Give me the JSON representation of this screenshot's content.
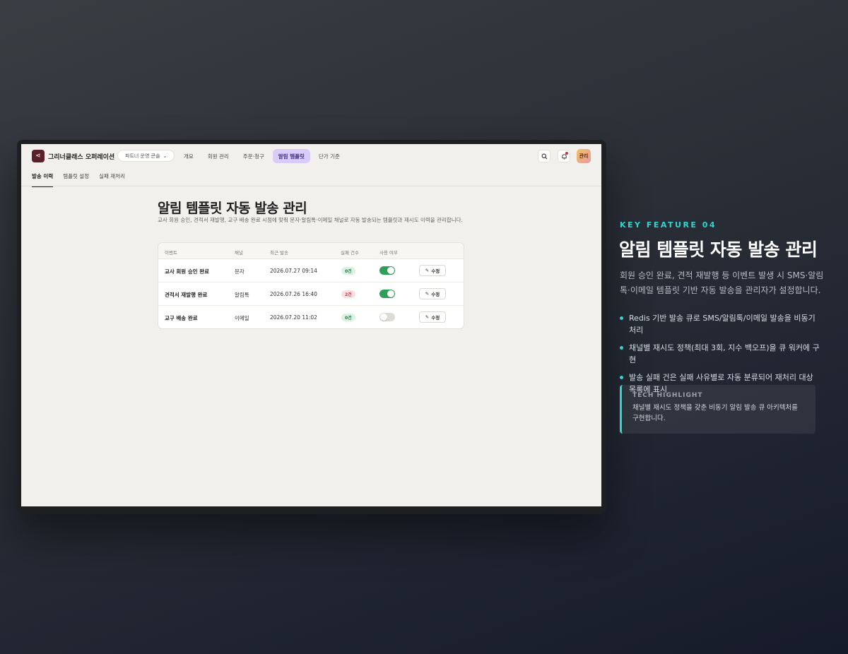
{
  "app": {
    "logo_glyph": "⋖",
    "brand": "그리너클래스 오퍼레이션",
    "workspace": "파트너 운영 콘솔",
    "nav": [
      "개요",
      "회원 관리",
      "주문·청구",
      "알림 템플릿",
      "단가 기준"
    ],
    "nav_active": "알림 템플릿",
    "avatar_label": "관리"
  },
  "subtabs": [
    "발송 이력",
    "템플릿 설정",
    "실패 재처리"
  ],
  "subtab_active": "발송 이력",
  "page": {
    "title": "알림 템플릿 자동 발송 관리",
    "description": "교사 회원 승인, 견적서 재발행, 교구 배송 완료 시점에 맞춰 문자·알림톡·이메일 채널로 자동 발송되는 템플릿과 재시도 이력을 관리합니다."
  },
  "table": {
    "headers": [
      "이벤트",
      "채널",
      "최근 발송",
      "실패 건수",
      "사용 여부"
    ],
    "edit_label": "수정",
    "rows": [
      {
        "event": "교사 회원 승인 완료",
        "channel": "문자",
        "last_sent": "2026.07.27 09:14",
        "failures": "0건",
        "failure_status": "ok",
        "enabled": true
      },
      {
        "event": "견적서 재발행 완료",
        "channel": "알림톡",
        "last_sent": "2026.07.26 16:40",
        "failures": "2건",
        "failure_status": "fail",
        "enabled": true
      },
      {
        "event": "교구 배송 완료",
        "channel": "이메일",
        "last_sent": "2026.07.20 11:02",
        "failures": "0건",
        "failure_status": "ok",
        "enabled": false
      }
    ]
  },
  "feature": {
    "kicker": "KEY FEATURE 04",
    "title": "알림 템플릿 자동 발송 관리",
    "description": "회원 승인 완료, 견적 재발행 등 이벤트 발생 시 SMS·알림톡·이메일 템플릿 기반 자동 발송을 관리자가 설정합니다.",
    "bullets": [
      "Redis 기반 발송 큐로 SMS/알림톡/이메일 발송을 비동기 처리",
      "채널별 재시도 정책(최대 3회, 지수 백오프)을 큐 워커에 구현",
      "발송 실패 건은 실패 사유별로 자동 분류되어 재처리 대상 목록에 표시"
    ],
    "highlight_label": "TECH HIGHLIGHT",
    "highlight_text": "채널별 재시도 정책을 갖춘 비동기 알림 발송 큐 아키텍처를 구현합니다."
  },
  "colors": {
    "accent": "#2fd6d0",
    "nav_active_bg": "#d9ccfb",
    "toggle_on": "#2f9e56",
    "fail_badge": "#c23545"
  }
}
